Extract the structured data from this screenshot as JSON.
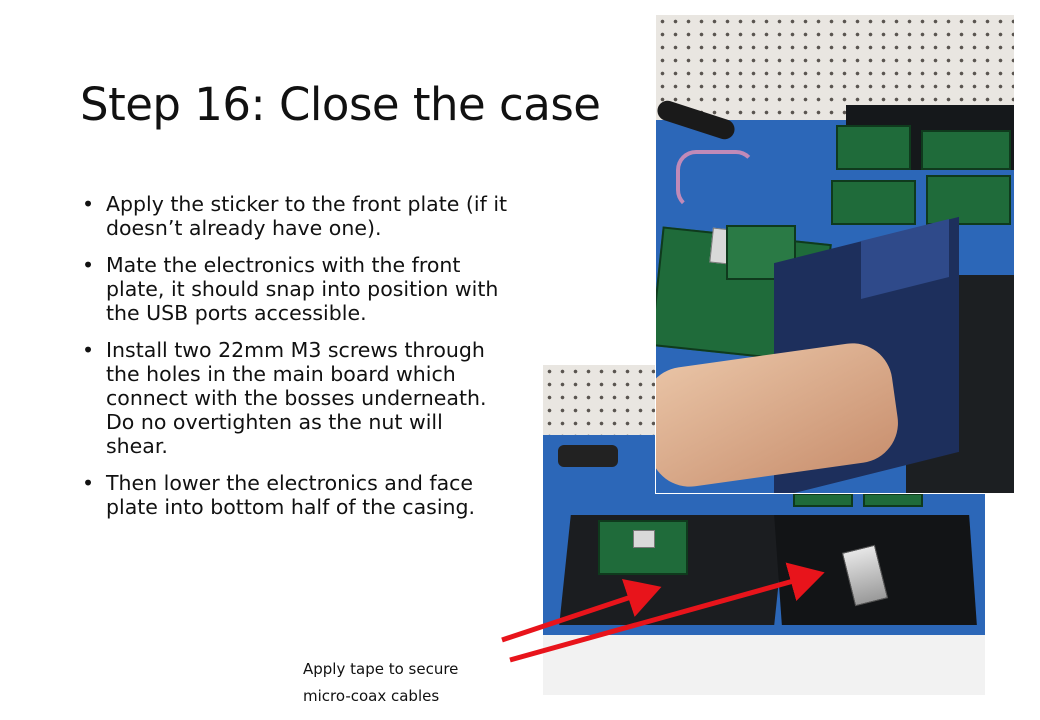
{
  "slide": {
    "title": "Step 16: Close the case",
    "bullet_marker": "•",
    "bullets": [
      "Apply the sticker to the front plate (if it doesn’t already have one).",
      "Mate the electronics with the front plate, it should snap into position with the USB ports accessible.",
      "Install two 22mm M3 screws through the holes in the main board which connect with the bosses underneath. Do no overtighten as the nut will shear.",
      "Then lower the electronics and face plate into bottom half of the casing."
    ],
    "caption_lines": [
      "Apply tape to secure",
      "micro-coax cables"
    ]
  },
  "colors": {
    "arrow": "#e8141b",
    "bench_blue": "#2c67b8",
    "pcb_green": "#1f6b3a"
  }
}
